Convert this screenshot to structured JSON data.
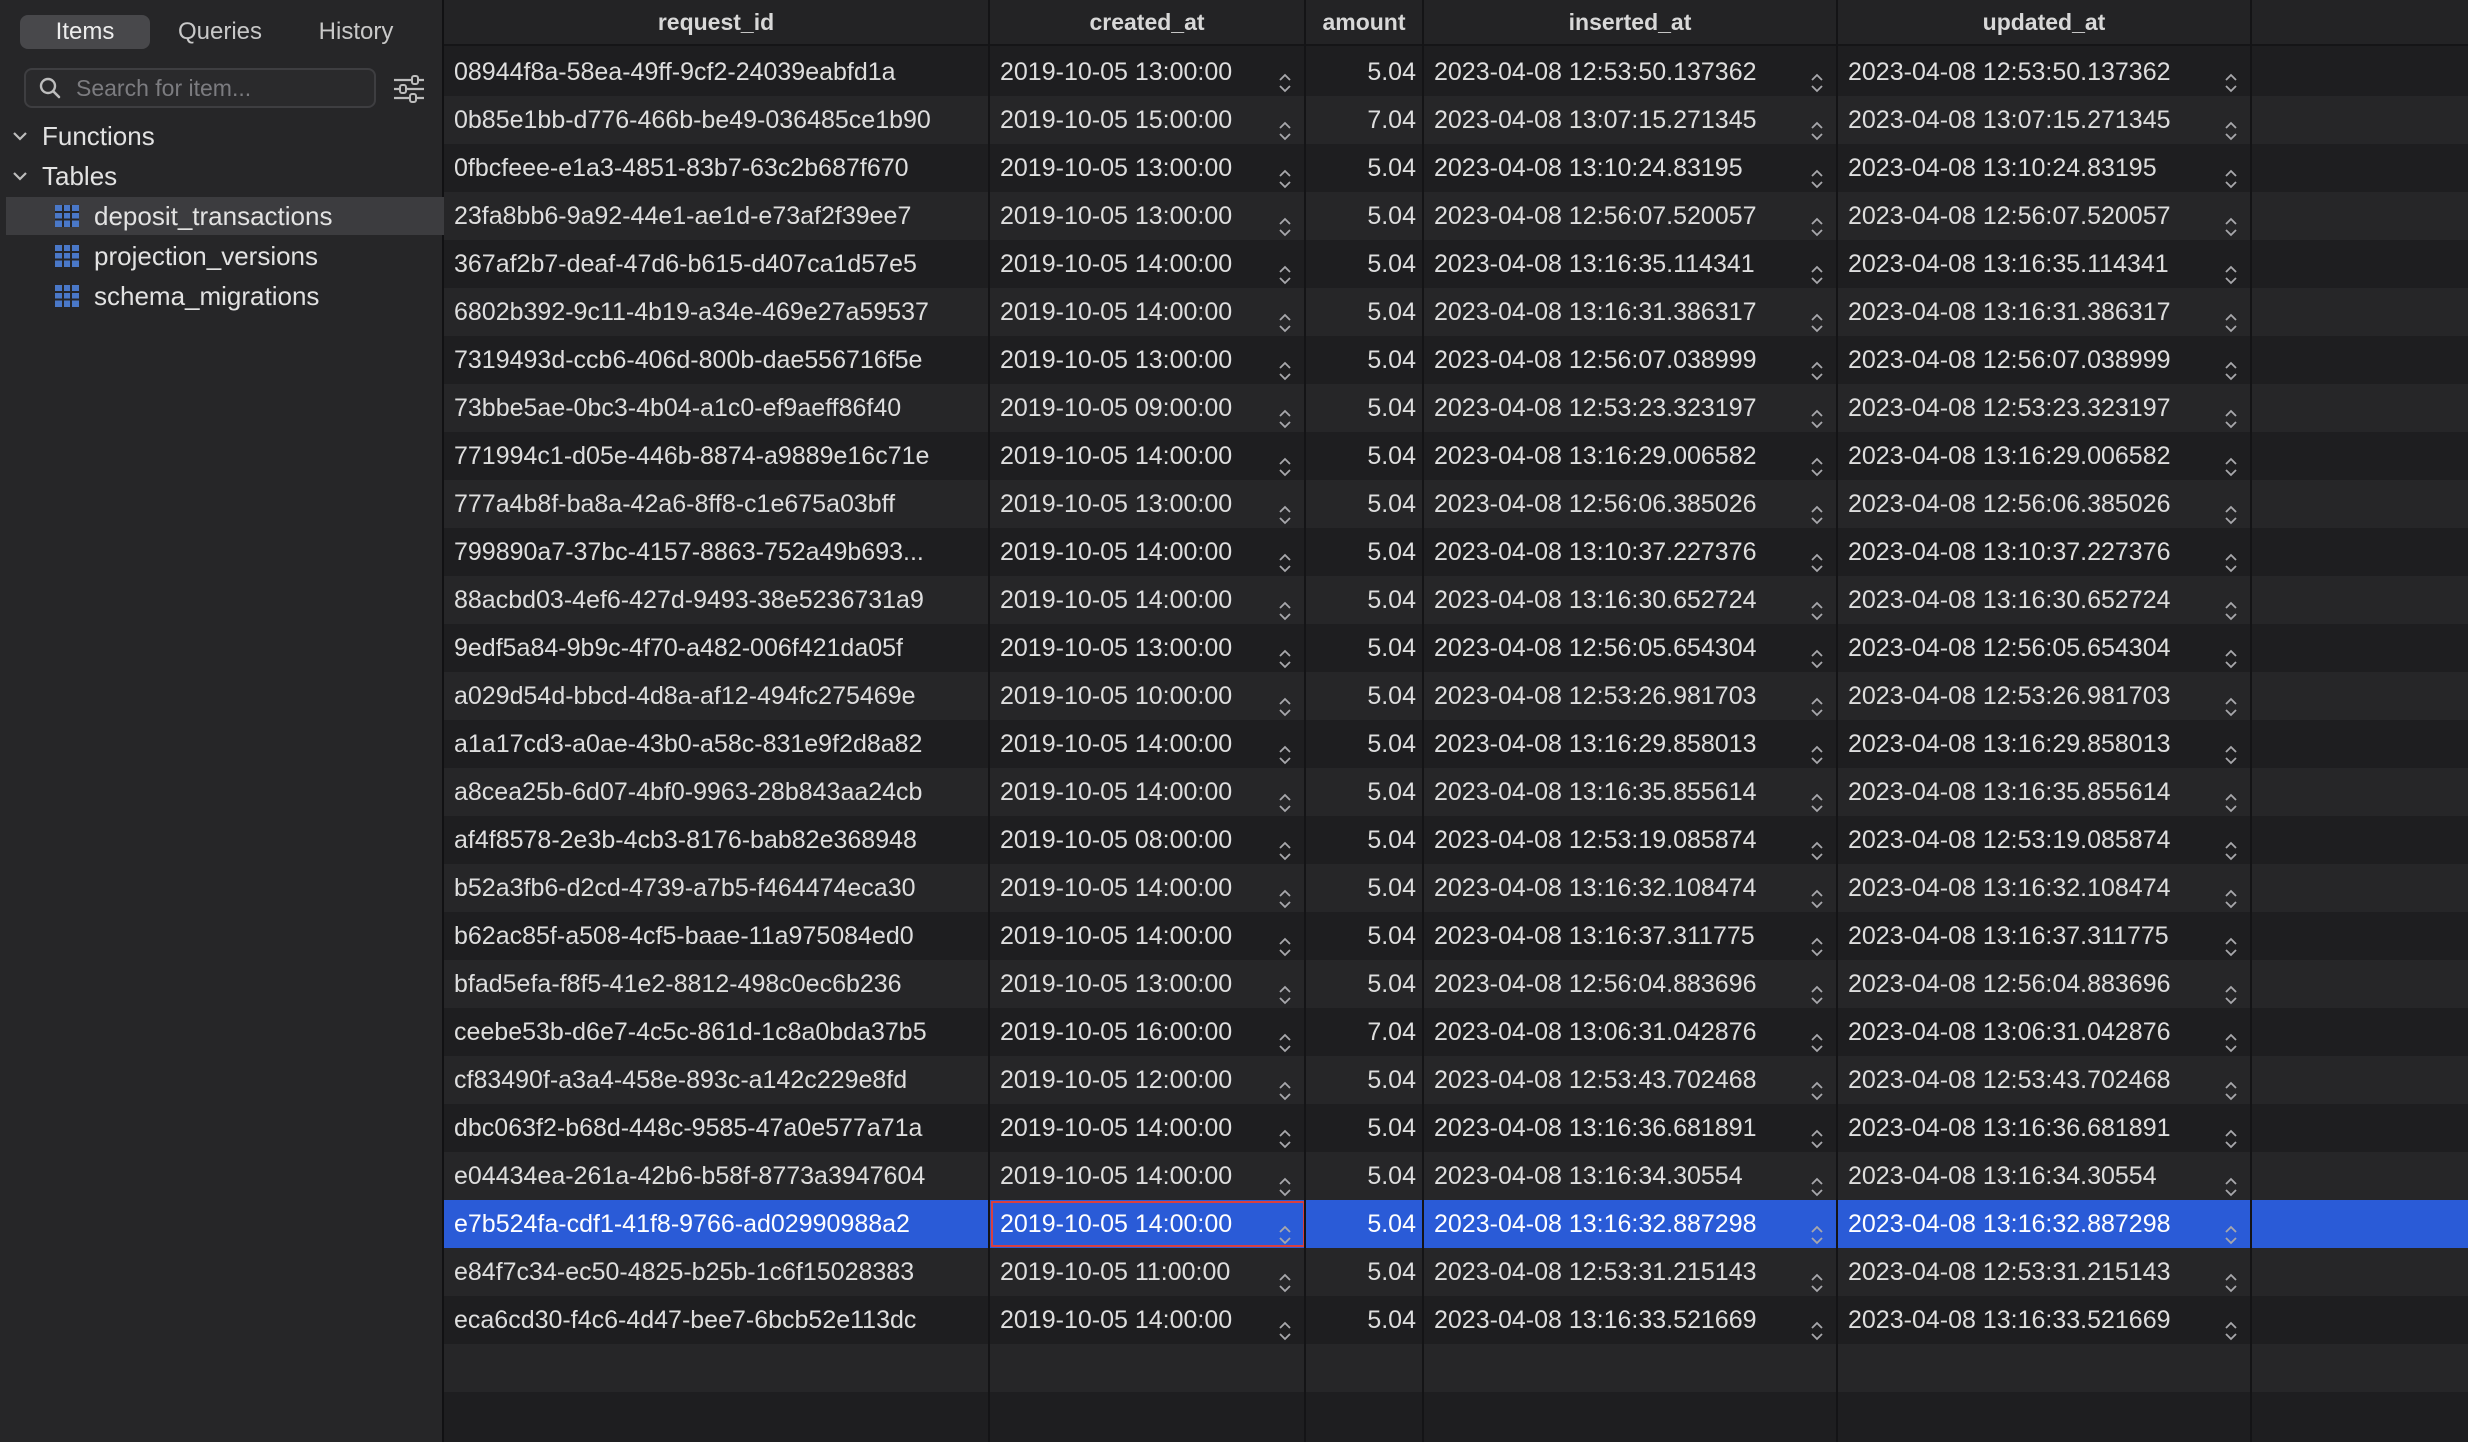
{
  "sidebar": {
    "tabs": [
      {
        "label": "Items",
        "active": true
      },
      {
        "label": "Queries",
        "active": false
      },
      {
        "label": "History",
        "active": false
      }
    ],
    "search": {
      "placeholder": "Search for item...",
      "value": ""
    },
    "sections": [
      {
        "label": "Functions",
        "expanded": true
      },
      {
        "label": "Tables",
        "expanded": true
      }
    ],
    "tables": [
      {
        "label": "deposit_transactions",
        "selected": true
      },
      {
        "label": "projection_versions",
        "selected": false
      },
      {
        "label": "schema_migrations",
        "selected": false
      }
    ]
  },
  "grid": {
    "columns": [
      "request_id",
      "created_at",
      "amount",
      "inserted_at",
      "updated_at"
    ],
    "selected_row": 24,
    "focused_cell": {
      "row": 24,
      "column": "created_at"
    },
    "rows": [
      {
        "request_id": "08944f8a-58ea-49ff-9cf2-24039eabfd1a",
        "created_at": "2019-10-05 13:00:00",
        "amount": "5.04",
        "inserted_at": "2023-04-08 12:53:50.137362",
        "updated_at": "2023-04-08 12:53:50.137362"
      },
      {
        "request_id": "0b85e1bb-d776-466b-be49-036485ce1b90",
        "created_at": "2019-10-05 15:00:00",
        "amount": "7.04",
        "inserted_at": "2023-04-08 13:07:15.271345",
        "updated_at": "2023-04-08 13:07:15.271345"
      },
      {
        "request_id": "0fbcfeee-e1a3-4851-83b7-63c2b687f670",
        "created_at": "2019-10-05 13:00:00",
        "amount": "5.04",
        "inserted_at": "2023-04-08 13:10:24.83195",
        "updated_at": "2023-04-08 13:10:24.83195"
      },
      {
        "request_id": "23fa8bb6-9a92-44e1-ae1d-e73af2f39ee7",
        "created_at": "2019-10-05 13:00:00",
        "amount": "5.04",
        "inserted_at": "2023-04-08 12:56:07.520057",
        "updated_at": "2023-04-08 12:56:07.520057"
      },
      {
        "request_id": "367af2b7-deaf-47d6-b615-d407ca1d57e5",
        "created_at": "2019-10-05 14:00:00",
        "amount": "5.04",
        "inserted_at": "2023-04-08 13:16:35.114341",
        "updated_at": "2023-04-08 13:16:35.114341"
      },
      {
        "request_id": "6802b392-9c11-4b19-a34e-469e27a59537",
        "created_at": "2019-10-05 14:00:00",
        "amount": "5.04",
        "inserted_at": "2023-04-08 13:16:31.386317",
        "updated_at": "2023-04-08 13:16:31.386317"
      },
      {
        "request_id": "7319493d-ccb6-406d-800b-dae556716f5e",
        "created_at": "2019-10-05 13:00:00",
        "amount": "5.04",
        "inserted_at": "2023-04-08 12:56:07.038999",
        "updated_at": "2023-04-08 12:56:07.038999"
      },
      {
        "request_id": "73bbe5ae-0bc3-4b04-a1c0-ef9aeff86f40",
        "created_at": "2019-10-05 09:00:00",
        "amount": "5.04",
        "inserted_at": "2023-04-08 12:53:23.323197",
        "updated_at": "2023-04-08 12:53:23.323197"
      },
      {
        "request_id": "771994c1-d05e-446b-8874-a9889e16c71e",
        "created_at": "2019-10-05 14:00:00",
        "amount": "5.04",
        "inserted_at": "2023-04-08 13:16:29.006582",
        "updated_at": "2023-04-08 13:16:29.006582"
      },
      {
        "request_id": "777a4b8f-ba8a-42a6-8ff8-c1e675a03bff",
        "created_at": "2019-10-05 13:00:00",
        "amount": "5.04",
        "inserted_at": "2023-04-08 12:56:06.385026",
        "updated_at": "2023-04-08 12:56:06.385026"
      },
      {
        "request_id": "799890a7-37bc-4157-8863-752a49b693...",
        "created_at": "2019-10-05 14:00:00",
        "amount": "5.04",
        "inserted_at": "2023-04-08 13:10:37.227376",
        "updated_at": "2023-04-08 13:10:37.227376"
      },
      {
        "request_id": "88acbd03-4ef6-427d-9493-38e5236731a9",
        "created_at": "2019-10-05 14:00:00",
        "amount": "5.04",
        "inserted_at": "2023-04-08 13:16:30.652724",
        "updated_at": "2023-04-08 13:16:30.652724"
      },
      {
        "request_id": "9edf5a84-9b9c-4f70-a482-006f421da05f",
        "created_at": "2019-10-05 13:00:00",
        "amount": "5.04",
        "inserted_at": "2023-04-08 12:56:05.654304",
        "updated_at": "2023-04-08 12:56:05.654304"
      },
      {
        "request_id": "a029d54d-bbcd-4d8a-af12-494fc275469e",
        "created_at": "2019-10-05 10:00:00",
        "amount": "5.04",
        "inserted_at": "2023-04-08 12:53:26.981703",
        "updated_at": "2023-04-08 12:53:26.981703"
      },
      {
        "request_id": "a1a17cd3-a0ae-43b0-a58c-831e9f2d8a82",
        "created_at": "2019-10-05 14:00:00",
        "amount": "5.04",
        "inserted_at": "2023-04-08 13:16:29.858013",
        "updated_at": "2023-04-08 13:16:29.858013"
      },
      {
        "request_id": "a8cea25b-6d07-4bf0-9963-28b843aa24cb",
        "created_at": "2019-10-05 14:00:00",
        "amount": "5.04",
        "inserted_at": "2023-04-08 13:16:35.855614",
        "updated_at": "2023-04-08 13:16:35.855614"
      },
      {
        "request_id": "af4f8578-2e3b-4cb3-8176-bab82e368948",
        "created_at": "2019-10-05 08:00:00",
        "amount": "5.04",
        "inserted_at": "2023-04-08 12:53:19.085874",
        "updated_at": "2023-04-08 12:53:19.085874"
      },
      {
        "request_id": "b52a3fb6-d2cd-4739-a7b5-f464474eca30",
        "created_at": "2019-10-05 14:00:00",
        "amount": "5.04",
        "inserted_at": "2023-04-08 13:16:32.108474",
        "updated_at": "2023-04-08 13:16:32.108474"
      },
      {
        "request_id": "b62ac85f-a508-4cf5-baae-11a975084ed0",
        "created_at": "2019-10-05 14:00:00",
        "amount": "5.04",
        "inserted_at": "2023-04-08 13:16:37.311775",
        "updated_at": "2023-04-08 13:16:37.311775"
      },
      {
        "request_id": "bfad5efa-f8f5-41e2-8812-498c0ec6b236",
        "created_at": "2019-10-05 13:00:00",
        "amount": "5.04",
        "inserted_at": "2023-04-08 12:56:04.883696",
        "updated_at": "2023-04-08 12:56:04.883696"
      },
      {
        "request_id": "ceebe53b-d6e7-4c5c-861d-1c8a0bda37b5",
        "created_at": "2019-10-05 16:00:00",
        "amount": "7.04",
        "inserted_at": "2023-04-08 13:06:31.042876",
        "updated_at": "2023-04-08 13:06:31.042876"
      },
      {
        "request_id": "cf83490f-a3a4-458e-893c-a142c229e8fd",
        "created_at": "2019-10-05 12:00:00",
        "amount": "5.04",
        "inserted_at": "2023-04-08 12:53:43.702468",
        "updated_at": "2023-04-08 12:53:43.702468"
      },
      {
        "request_id": "dbc063f2-b68d-448c-9585-47a0e577a71a",
        "created_at": "2019-10-05 14:00:00",
        "amount": "5.04",
        "inserted_at": "2023-04-08 13:16:36.681891",
        "updated_at": "2023-04-08 13:16:36.681891"
      },
      {
        "request_id": "e04434ea-261a-42b6-b58f-8773a3947604",
        "created_at": "2019-10-05 14:00:00",
        "amount": "5.04",
        "inserted_at": "2023-04-08 13:16:34.30554",
        "updated_at": "2023-04-08 13:16:34.30554"
      },
      {
        "request_id": "e7b524fa-cdf1-41f8-9766-ad02990988a2",
        "created_at": "2019-10-05 14:00:00",
        "amount": "5.04",
        "inserted_at": "2023-04-08 13:16:32.887298",
        "updated_at": "2023-04-08 13:16:32.887298"
      },
      {
        "request_id": "e84f7c34-ec50-4825-b25b-1c6f15028383",
        "created_at": "2019-10-05 11:00:00",
        "amount": "5.04",
        "inserted_at": "2023-04-08 12:53:31.215143",
        "updated_at": "2023-04-08 12:53:31.215143"
      },
      {
        "request_id": "eca6cd30-f4c6-4d47-bee7-6bcb52e113dc",
        "created_at": "2019-10-05 14:00:00",
        "amount": "5.04",
        "inserted_at": "2023-04-08 13:16:33.521669",
        "updated_at": "2023-04-08 13:16:33.521669"
      }
    ]
  },
  "colors": {
    "selection": "#2a5bd7",
    "focus_outline": "#d84040",
    "table_icon": "#4a78c8"
  },
  "icons": [
    "search-icon",
    "filter-icon",
    "chevron-down-icon",
    "table-icon",
    "stepper-icon"
  ]
}
